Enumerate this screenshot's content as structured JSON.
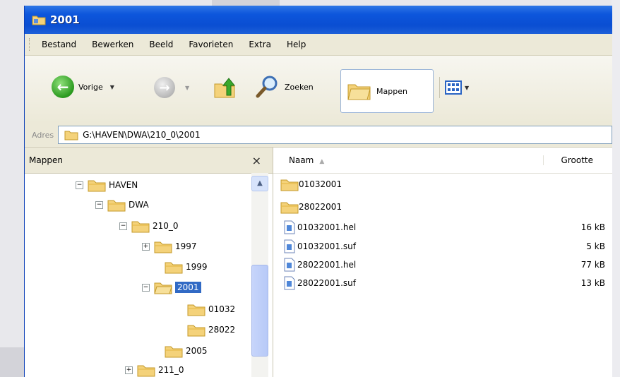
{
  "window": {
    "title": "2001",
    "title_color": "#0a4ed2"
  },
  "menu": [
    "Bestand",
    "Bewerken",
    "Beeld",
    "Favorieten",
    "Extra",
    "Help"
  ],
  "toolbar": {
    "back_label": "Vorige",
    "search_label": "Zoeken",
    "folders_label": "Mappen",
    "back_icon": "green-arrow-left-icon",
    "forward_icon": "grey-arrow-right-icon",
    "up_icon": "folder-up-icon",
    "search_icon": "magnifier-icon",
    "folders_icon": "folders-icon",
    "views_icon": "views-grid-icon"
  },
  "address": {
    "label": "Adres",
    "value": "G:\\HAVEN\\DWA\\210_0\\2001"
  },
  "folders_pane": {
    "title": "Mappen",
    "close": "×",
    "tree": [
      {
        "label": "HAVEN",
        "toggle": "−"
      },
      {
        "label": "DWA",
        "toggle": "−"
      },
      {
        "label": "210_0",
        "toggle": "−"
      },
      {
        "label": "1997",
        "toggle": "+"
      },
      {
        "label": "1999",
        "toggle": ""
      },
      {
        "label": "2001",
        "toggle": "−",
        "selected": true
      },
      {
        "label": "01032",
        "toggle": ""
      },
      {
        "label": "28022",
        "toggle": ""
      },
      {
        "label": "2005",
        "toggle": ""
      },
      {
        "label": "211_0",
        "toggle": "+"
      }
    ]
  },
  "files": {
    "columns": {
      "name": "Naam",
      "size": "Grootte",
      "sort_indicator": "▲"
    },
    "rows": [
      {
        "name": "01032001",
        "size": "",
        "type": "folder"
      },
      {
        "name": "28022001",
        "size": "",
        "type": "folder"
      },
      {
        "name": "01032001.hel",
        "size": "16 kB",
        "type": "file"
      },
      {
        "name": "01032001.suf",
        "size": "5 kB",
        "type": "file"
      },
      {
        "name": "28022001.hel",
        "size": "77 kB",
        "type": "file"
      },
      {
        "name": "28022001.suf",
        "size": "13 kB",
        "type": "file"
      }
    ]
  }
}
